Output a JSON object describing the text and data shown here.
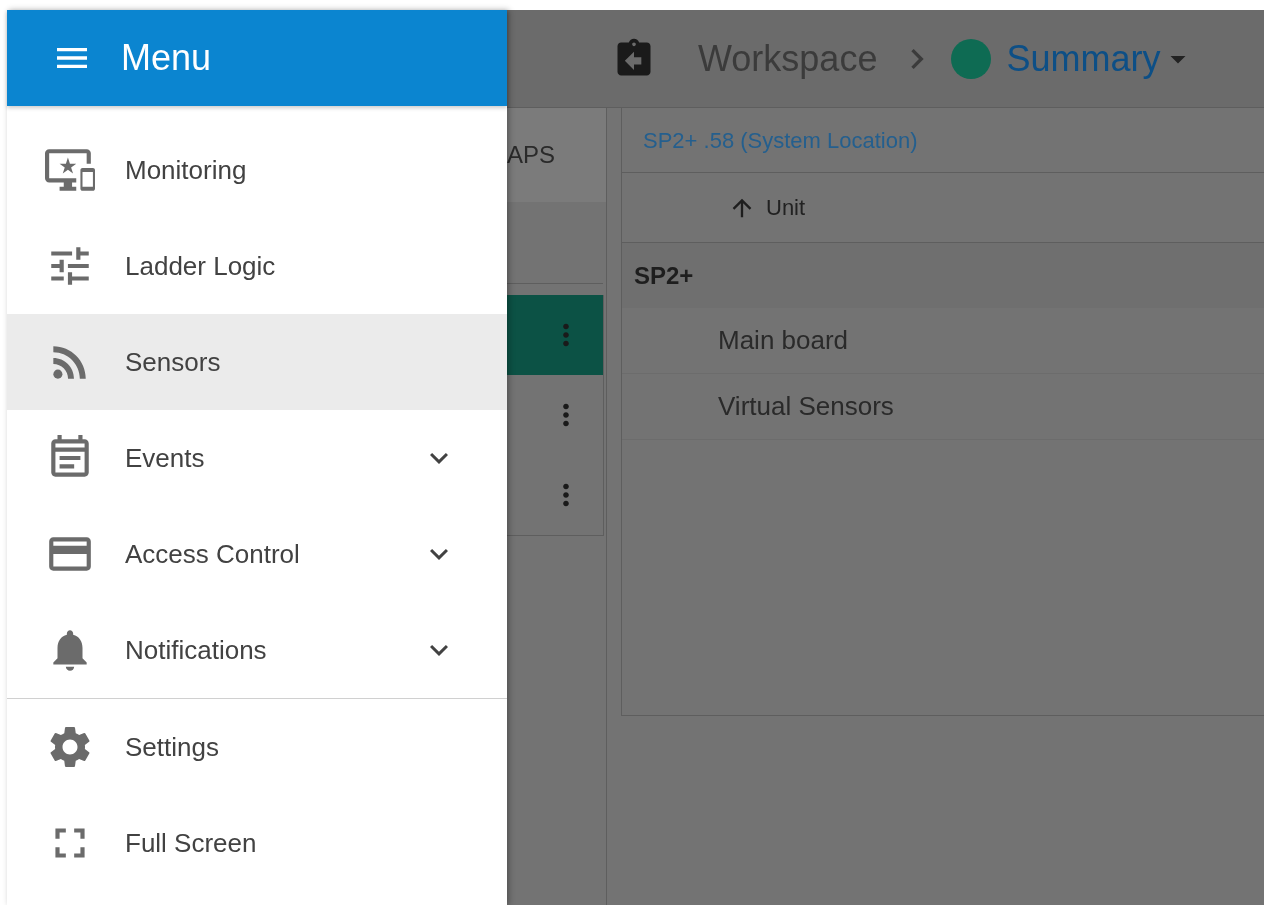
{
  "menu": {
    "title": "Menu",
    "sections": [
      [
        {
          "label": "Monitoring",
          "selected": false,
          "expandable": false
        },
        {
          "label": "Ladder Logic",
          "selected": false,
          "expandable": false
        },
        {
          "label": "Sensors",
          "selected": true,
          "expandable": false
        },
        {
          "label": "Events",
          "selected": false,
          "expandable": true
        },
        {
          "label": "Access Control",
          "selected": false,
          "expandable": true
        },
        {
          "label": "Notifications",
          "selected": false,
          "expandable": true
        }
      ],
      [
        {
          "label": "Settings",
          "selected": false,
          "expandable": false
        },
        {
          "label": "Full Screen",
          "selected": false,
          "expandable": false
        }
      ]
    ]
  },
  "breadcrumb": {
    "parent": "Workspace",
    "current": {
      "label": "Summary",
      "color": "#0e6b53"
    }
  },
  "left_panel": {
    "tab": "APS",
    "rows": [
      {
        "selected": true
      },
      {
        "selected": false
      },
      {
        "selected": false
      }
    ]
  },
  "right_panel": {
    "title": "SP2+ .58 (System Location)",
    "column": {
      "label": "Unit",
      "sort_ascending": true
    },
    "group": "SP2+",
    "rows": [
      "Main board",
      "Virtual Sensors"
    ]
  }
}
